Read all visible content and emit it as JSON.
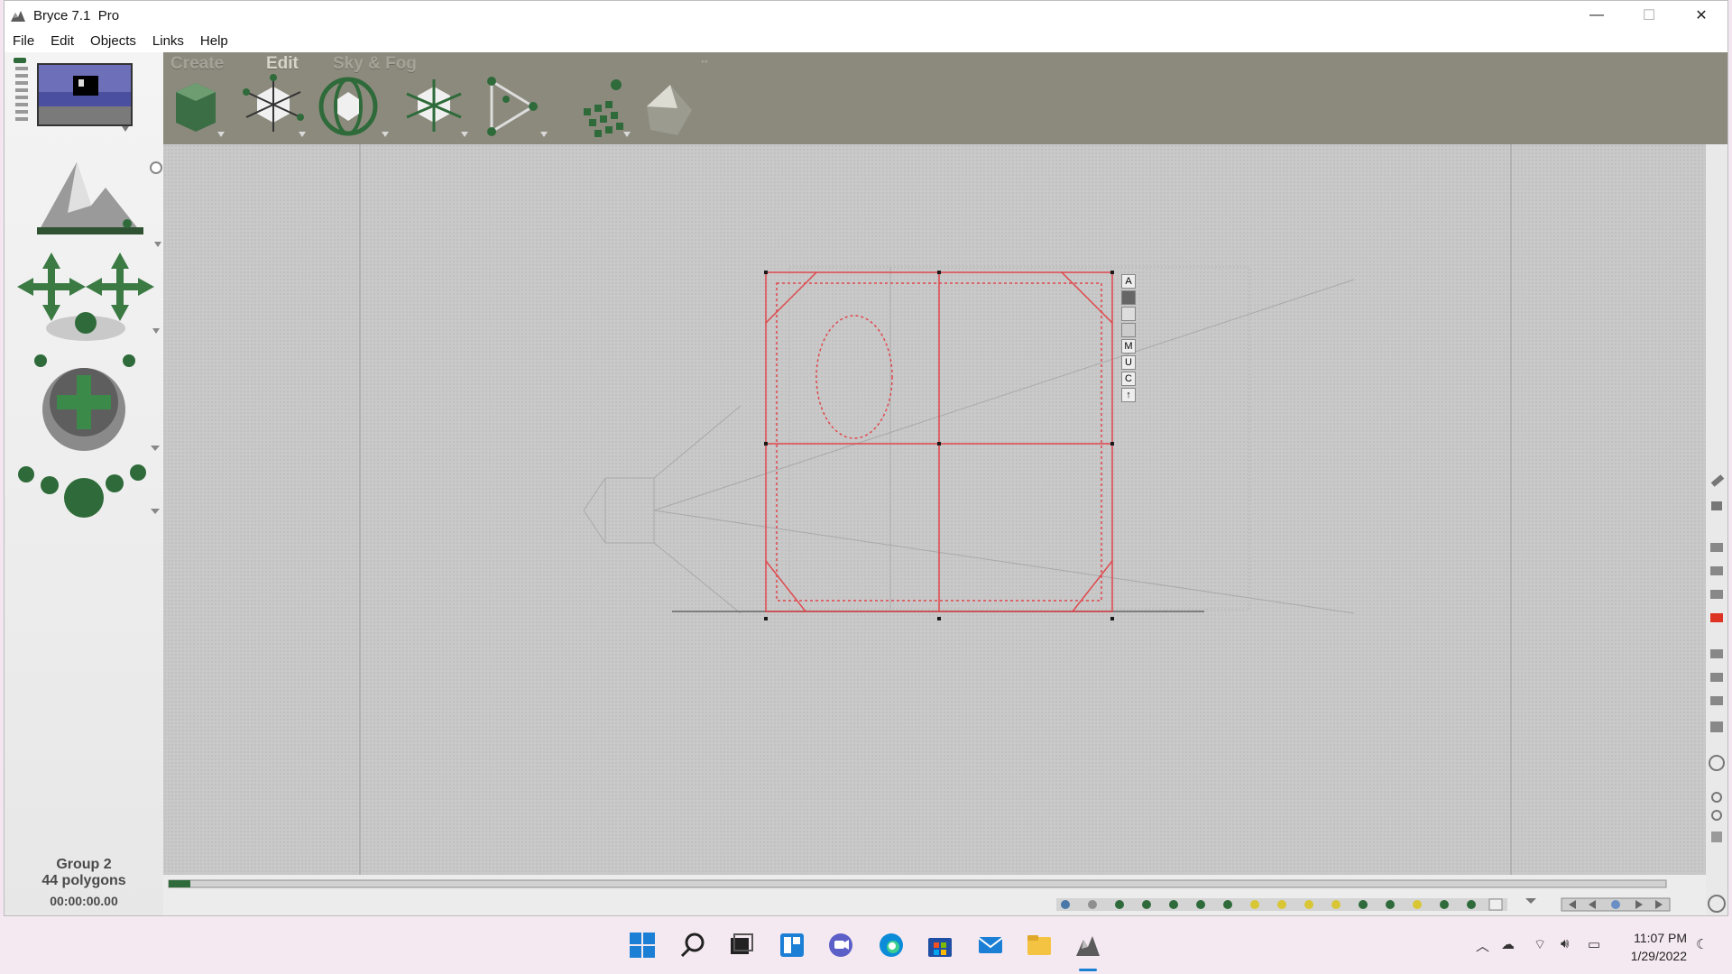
{
  "window": {
    "title": "Bryce 7.1  Pro",
    "minimize": "—",
    "maximize": "☐",
    "close": "✕"
  },
  "menu": {
    "items": [
      "File",
      "Edit",
      "Objects",
      "Links",
      "Help"
    ]
  },
  "toolbar": {
    "tabs": [
      "Create",
      "Edit",
      "Sky & Fog"
    ],
    "active_tab": "Edit"
  },
  "selection_palette": {
    "letters": [
      "A",
      "",
      "",
      "",
      "M",
      "U",
      "C",
      "↑"
    ]
  },
  "status": {
    "object_name": "Group 2",
    "polygons": "44 polygons",
    "time": "00:00:00.00"
  },
  "taskbar": {
    "apps": [
      "start-icon",
      "search-icon",
      "task-view-icon",
      "widgets-icon",
      "chat-icon",
      "edge-icon",
      "store-icon",
      "mail-icon",
      "file-explorer-icon",
      "bryce-icon"
    ],
    "clock_time": "11:07 PM",
    "clock_date": "1/29/2022"
  },
  "colors": {
    "toolbar_bg": "#8c8a7d",
    "canvas_bg": "#c9c9c9",
    "selection_red": "#e0474c",
    "taskbar_bg": "#f5e9f1",
    "accent_green": "#2f6b3a"
  }
}
